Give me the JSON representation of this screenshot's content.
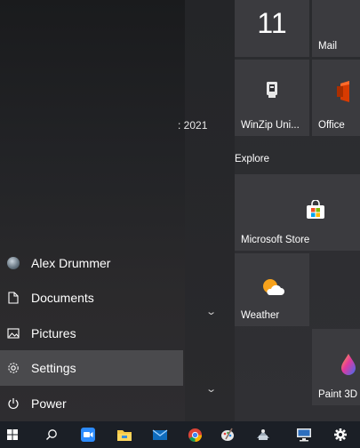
{
  "nav": {
    "user": "Alex Drummer",
    "documents": "Documents",
    "pictures": "Pictures",
    "settings": "Settings",
    "power": "Power"
  },
  "app_list": {
    "partial_text": ": 2021"
  },
  "tiles": {
    "calendar_day": "11",
    "mail": "Mail",
    "winzip": "WinZip Uni...",
    "office": "Office",
    "explore_group": "Explore",
    "store": "Microsoft Store",
    "weather": "Weather",
    "paint3d": "Paint 3D"
  },
  "taskbar": {
    "icons": [
      "windows-start-icon",
      "search-icon",
      "zoom-icon",
      "file-explorer-icon",
      "mail-icon",
      "chrome-icon",
      "paint-icon",
      "network-icon",
      "remote-desktop-icon",
      "settings-icon"
    ]
  },
  "colors": {
    "accent_blue": "#0078d4",
    "office_red": "#d83b01",
    "weather_orange": "#f7a21b"
  }
}
